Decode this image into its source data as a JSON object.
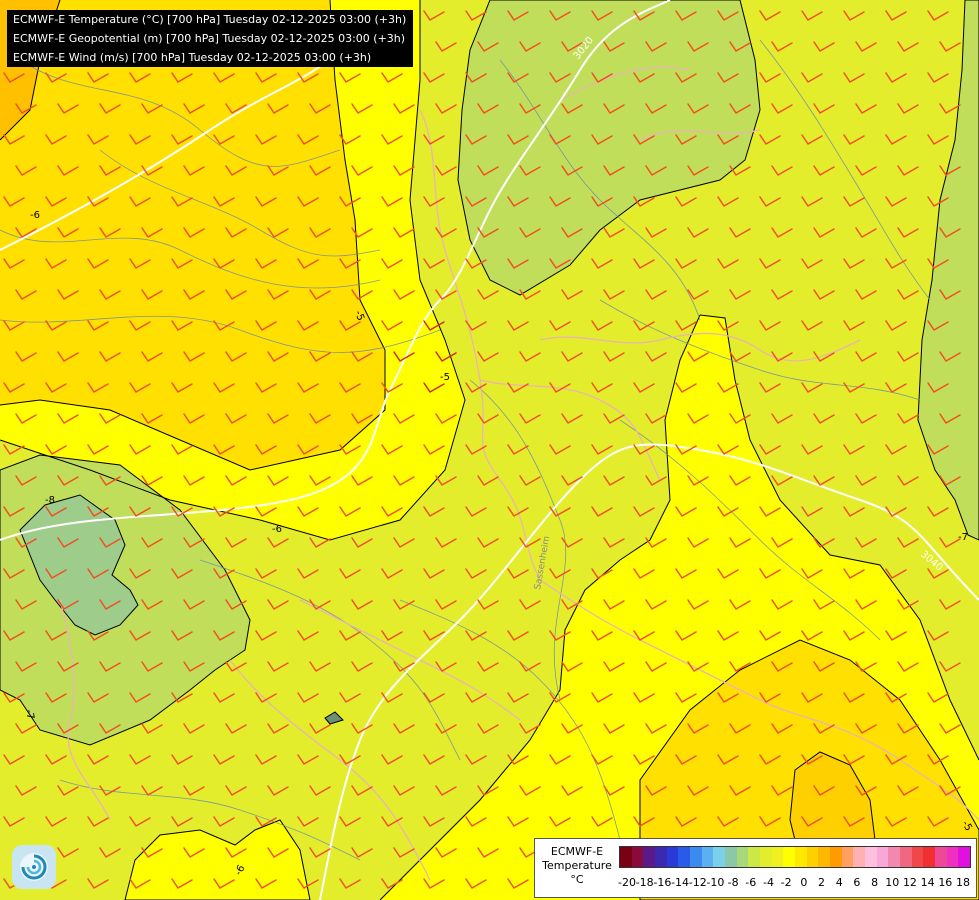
{
  "header": {
    "lines": [
      "ECMWF-E Temperature (°C) [700 hPa] Tuesday 02-12-2025 03:00 (+3h)",
      "ECMWF-E Geopotential (m) [700 hPa] Tuesday 02-12-2025 03:00 (+3h)",
      "ECMWF-E Wind (m/s) [700 hPa] Tuesday 02-12-2025 03:00 (+3h)"
    ]
  },
  "legend": {
    "title_lines": [
      "ECMWF-E",
      "Temperature",
      "°C"
    ],
    "ticks": [
      "-20",
      "-18",
      "-16",
      "-14",
      "-12",
      "-10",
      "-8",
      "-6",
      "-4",
      "-2",
      "0",
      "2",
      "4",
      "6",
      "8",
      "10",
      "12",
      "14",
      "16",
      "18"
    ],
    "colors": [
      "#7a0014",
      "#8a0a3c",
      "#5a1a8a",
      "#3a2ab0",
      "#2a3ad8",
      "#2a5ae8",
      "#3a8af0",
      "#5ab0f0",
      "#7ad0e8",
      "#8ac8a8",
      "#a8d87a",
      "#cce848",
      "#e4ed2c",
      "#f0f020",
      "#ffff00",
      "#ffe800",
      "#ffd000",
      "#ffb800",
      "#ff9a00",
      "#ffa060",
      "#ffb0b0",
      "#ffc0e0",
      "#f8a8d8",
      "#f088b0",
      "#f06880",
      "#f04848",
      "#f03030",
      "#f04898",
      "#f030c0",
      "#e010e0"
    ]
  },
  "map": {
    "isotherm_labels": [
      "-5",
      "-6",
      "-6",
      "-8",
      "-7",
      "-6",
      "-5",
      "-5",
      "-7"
    ],
    "geopotential_labels": [
      "3020",
      "3040"
    ],
    "place_label": "Sassenheim",
    "colors": {
      "warm_orange": "#ffc000",
      "deep_yellow": "#ffe000",
      "yellow": "#ffff00",
      "lime": "#e4ed2c",
      "green": "#c1de5a",
      "teal": "#9ecc8a",
      "wind_barb": "#f05020",
      "border": "#e8b4b4",
      "river": "#6a8aa8",
      "contour": "#000000",
      "geopotential": "#ffffff"
    }
  },
  "logo": {
    "icon": "ecmwf-swirl-icon"
  }
}
